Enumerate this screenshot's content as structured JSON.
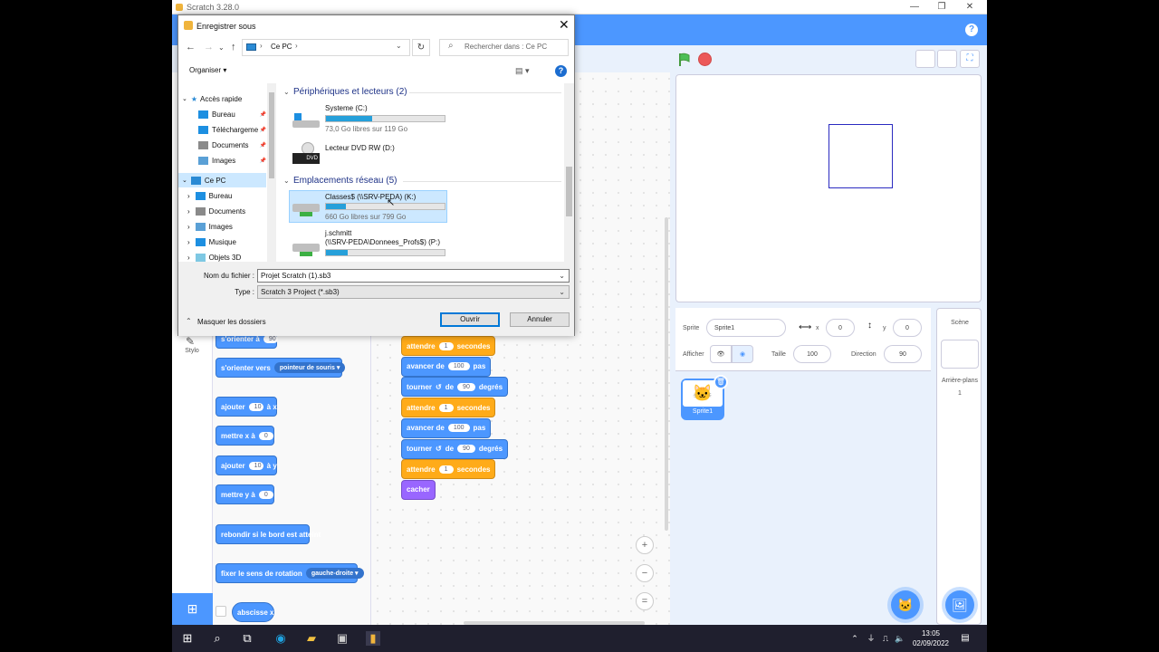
{
  "scratch": {
    "window_title": "Scratch 3.28.0",
    "help_glyph": "?",
    "category_stylo": "Stylo",
    "palette_blocks": {
      "orient_label": "s'orienter à",
      "orient_value": "90",
      "orient_towards_label": "s'orienter vers",
      "orient_towards_value": "pointeur de souris",
      "add_x_label": "ajouter",
      "add_x_value": "10",
      "add_x_suffix": "à x",
      "set_x_label": "mettre x à",
      "set_x_value": "0",
      "add_y_label": "ajouter",
      "add_y_value": "10",
      "add_y_suffix": "à y",
      "set_y_label": "mettre y à",
      "set_y_value": "0",
      "bounce_label": "rebondir si le bord est atteint",
      "rotation_label": "fixer le sens de rotation",
      "rotation_value": "gauche-droite",
      "xpos_label": "abscisse x"
    },
    "script_blocks": [
      {
        "kind": "wait",
        "label": "attendre",
        "value": "1",
        "suffix": "secondes"
      },
      {
        "kind": "move",
        "label": "avancer de",
        "value": "100",
        "suffix": "pas"
      },
      {
        "kind": "turn",
        "label": "tourner",
        "mid": "de",
        "value": "90",
        "suffix": "degrés"
      },
      {
        "kind": "wait",
        "label": "attendre",
        "value": "1",
        "suffix": "secondes"
      },
      {
        "kind": "move",
        "label": "avancer de",
        "value": "100",
        "suffix": "pas"
      },
      {
        "kind": "turn",
        "label": "tourner",
        "mid": "de",
        "value": "90",
        "suffix": "degrés"
      },
      {
        "kind": "wait",
        "label": "attendre",
        "value": "1",
        "suffix": "secondes"
      },
      {
        "kind": "hide",
        "label": "cacher"
      }
    ],
    "zoom_in": "+",
    "zoom_out": "−",
    "zoom_reset": "=",
    "sprite_info": {
      "sprite_label": "Sprite",
      "sprite_name": "Sprite1",
      "x_label": "x",
      "x_value": "0",
      "y_label": "y",
      "y_value": "0",
      "show_label": "Afficher",
      "size_label": "Taille",
      "size_value": "100",
      "direction_label": "Direction",
      "direction_value": "90"
    },
    "sprite_thumb_label": "Sprite1",
    "scene": {
      "title": "Scène",
      "backdrops_label": "Arrière-plans",
      "backdrops_count": "1"
    }
  },
  "dialog": {
    "title": "Enregistrer sous",
    "close_glyph": "✕",
    "address": "Ce PC",
    "search_placeholder": "Rechercher dans : Ce PC",
    "organiser": "Organiser ▾",
    "help_glyph": "?",
    "nav": {
      "quick_access": "Accès rapide",
      "quick_items": [
        "Bureau",
        "Téléchargeme",
        "Documents",
        "Images"
      ],
      "this_pc": "Ce PC",
      "pc_items": [
        "Bureau",
        "Documents",
        "Images",
        "Musique",
        "Objets 3D"
      ]
    },
    "groups": {
      "devices": "Périphériques et lecteurs (2)",
      "network": "Emplacements réseau (5)"
    },
    "drives": [
      {
        "name": "Systeme (C:)",
        "free": "73,0 Go libres sur 119 Go",
        "used_fraction": 0.39
      },
      {
        "name": "Lecteur DVD RW (D:)"
      },
      {
        "name": "Classes$ (\\\\SRV-PEDA) (K:)",
        "free": "660 Go libres sur 799 Go",
        "used_fraction": 0.17
      },
      {
        "name": "j.schmitt",
        "name2": "(\\\\SRV-PEDA\\Donnees_Profs$) (P:)",
        "used_fraction": 0.18
      }
    ],
    "dvd_badge": "DVD",
    "filename_label": "Nom du fichier :",
    "filename_value": "Projet Scratch (1).sb3",
    "type_label": "Type :",
    "type_value": "Scratch 3 Project (*.sb3)",
    "hide_folders": "Masquer les dossiers",
    "open_button": "Ouvrir",
    "cancel_button": "Annuler"
  },
  "taskbar": {
    "time": "13:05",
    "date": "02/09/2022"
  },
  "colors": {
    "scratch_blue": "#4c97ff",
    "motion_block": "#4c97ff",
    "control_block": "#ffab19",
    "looks_block": "#9966ff",
    "win_accent": "#26a0da"
  }
}
